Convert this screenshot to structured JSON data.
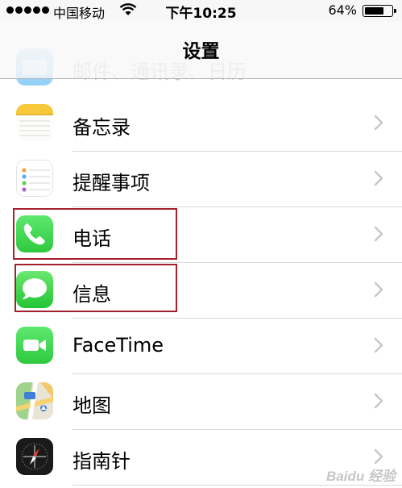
{
  "status_bar": {
    "carrier": "中国移动",
    "time": "下午10:25",
    "battery_percent": "64%",
    "battery_level": 0.64
  },
  "nav": {
    "title": "设置"
  },
  "rows": [
    {
      "label": "邮件、通讯录、日历",
      "icon": "mail-icon",
      "partial": true
    },
    {
      "label": "备忘录",
      "icon": "notes-icon"
    },
    {
      "label": "提醒事项",
      "icon": "reminders-icon"
    },
    {
      "label": "电话",
      "icon": "phone-icon",
      "highlighted": true
    },
    {
      "label": "信息",
      "icon": "messages-icon",
      "highlighted": true
    },
    {
      "label": "FaceTime",
      "icon": "facetime-icon"
    },
    {
      "label": "地图",
      "icon": "maps-icon"
    },
    {
      "label": "指南针",
      "icon": "compass-icon"
    }
  ],
  "colors": {
    "highlight_border": "#a3212d",
    "phone_green": "#4cd964",
    "separator": "#d9d9d9"
  },
  "watermark": "Baidu 经验"
}
